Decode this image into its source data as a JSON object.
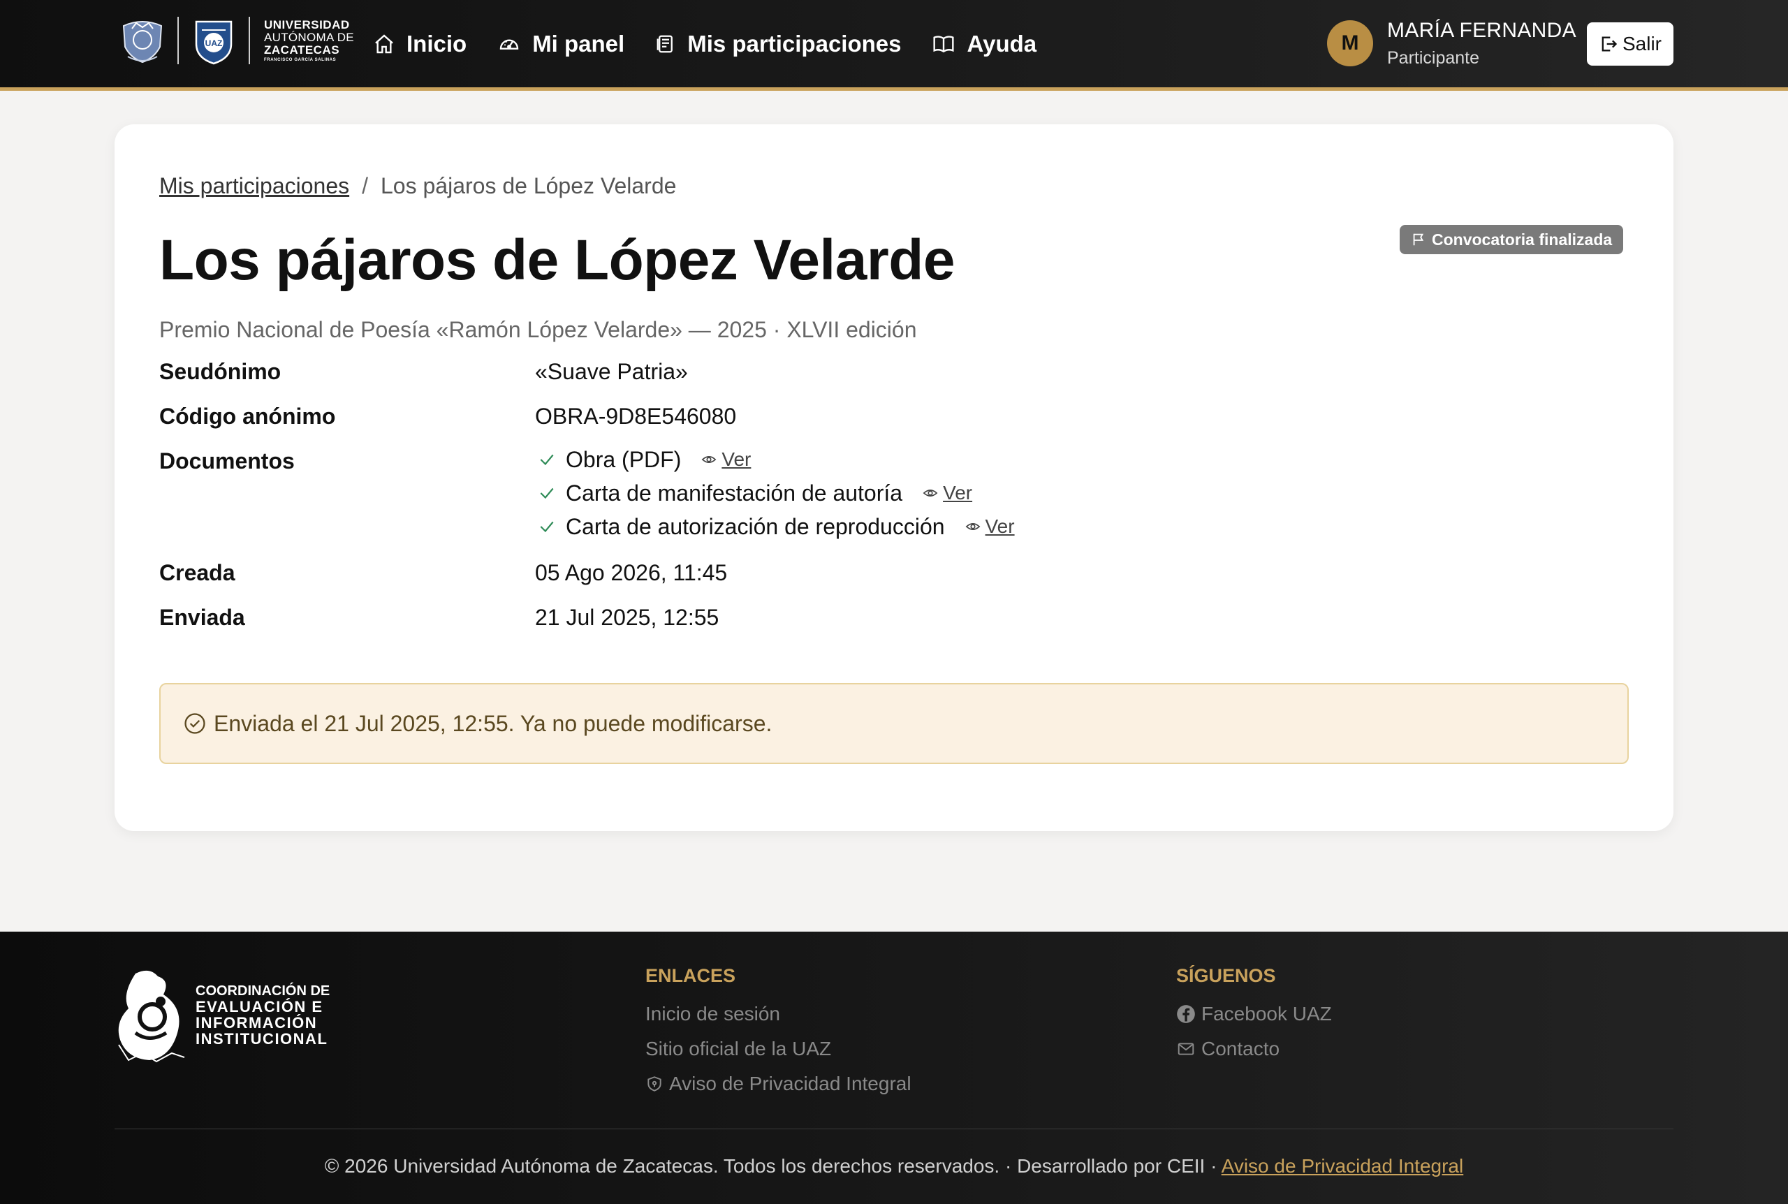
{
  "brand": {
    "line1": "UNIVERSIDAD",
    "line2": "AUTÓNOMA DE",
    "line3": "ZACATECAS",
    "line4": "FRANCISCO GARCÍA SALINAS",
    "seal_text": "UAZ"
  },
  "nav": {
    "items": [
      {
        "label": "Inicio",
        "icon": "home-icon"
      },
      {
        "label": "Mi panel",
        "icon": "gauge-icon"
      },
      {
        "label": "Mis participaciones",
        "icon": "document-list-icon"
      },
      {
        "label": "Ayuda",
        "icon": "book-icon"
      }
    ]
  },
  "user": {
    "initial": "M",
    "name": "MARÍA FERNANDA",
    "role": "Participante",
    "logout_label": "Salir"
  },
  "breadcrumb": {
    "parent": "Mis participaciones",
    "separator": "/",
    "current": "Los pájaros de López Velarde"
  },
  "status_badge": "Convocatoria finalizada",
  "work": {
    "title": "Los pájaros de López Velarde",
    "subtitle": "Premio Nacional de Poesía «Ramón López Velarde» — 2025 · XLVII edición",
    "pseudonym_label": "Seudónimo",
    "pseudonym": "«Suave Patria»",
    "code_label": "Código anónimo",
    "code": "OBRA-9D8E546080",
    "documents_label": "Documentos",
    "documents": [
      {
        "name": "Obra (PDF)",
        "action": "Ver"
      },
      {
        "name": "Carta de manifestación de autoría",
        "action": "Ver"
      },
      {
        "name": "Carta de autorización de reproducción",
        "action": "Ver"
      }
    ],
    "created_label": "Creada",
    "created": "05 Ago 2026, 11:45",
    "sent_label": "Enviada",
    "sent": "21 Jul 2025, 12:55"
  },
  "alert": {
    "text": "Enviada el 21 Jul 2025, 12:55. Ya no puede modificarse."
  },
  "footer": {
    "ceii": {
      "line1": "COORDINACIÓN DE",
      "line2": "EVALUACIÓN E",
      "line3": "INFORMACIÓN",
      "line4": "INSTITUCIONAL"
    },
    "links_title": "ENLACES",
    "links": [
      "Inicio de sesión",
      "Sitio oficial de la UAZ",
      "Aviso de Privacidad Integral"
    ],
    "follow_title": "SÍGUENOS",
    "follow": [
      "Facebook UAZ",
      "Contacto"
    ],
    "copyright": "© 2026 Universidad Autónoma de Zacatecas. Todos los derechos reservados. · Desarrollado por CEII · ",
    "privacy_link": "Aviso de Privacidad Integral"
  },
  "colors": {
    "accent_gold": "#c9a25c",
    "navbar_bg": "#151515",
    "success_check": "#2e8b57",
    "alert_bg": "#fbf1e2",
    "badge_bg": "#7a7a7a"
  }
}
